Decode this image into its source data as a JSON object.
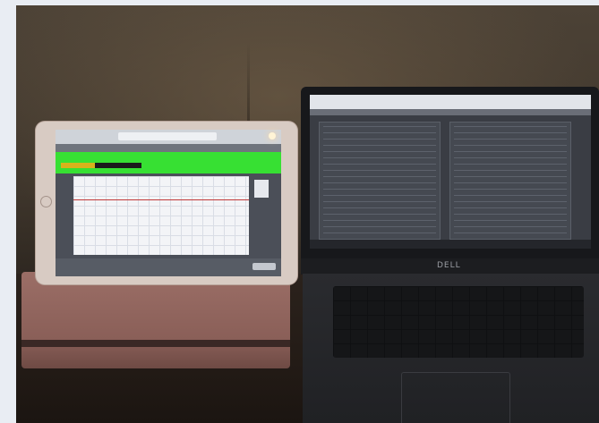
{
  "scene": {
    "laptop": {
      "brand": "DELL"
    },
    "colors": {
      "app_green": "#37e033",
      "level_yellow": "#d6b31b",
      "chart_line": "#c23a3a",
      "wall": "#4c4236",
      "desk": "#231b16",
      "ipad_case": "#8a5f58"
    }
  }
}
